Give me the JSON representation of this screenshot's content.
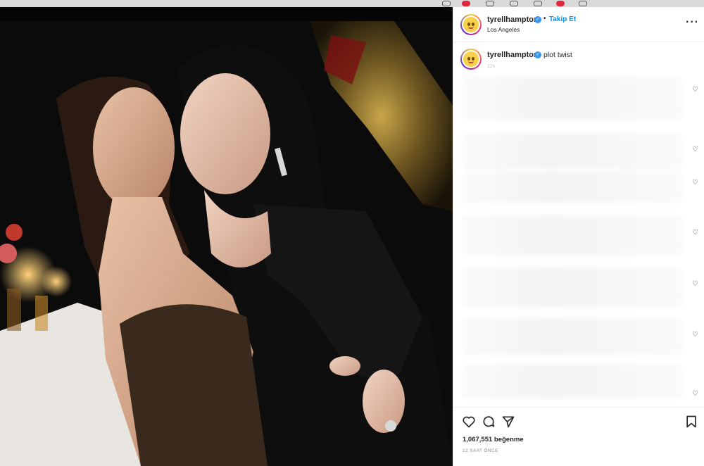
{
  "colors": {
    "accent": "#0095f6",
    "verified": "#3897f0",
    "text": "#262626",
    "muted": "#8e8e8e"
  },
  "post": {
    "username": "tyrellhampton",
    "follow_label": "Takip Et",
    "separator": "•",
    "location": "Los Angeles",
    "more_icon": "more-horizontal-icon"
  },
  "caption": {
    "username": "tyrellhampton",
    "text": "plot twist",
    "time": "12s"
  },
  "comments": {
    "like_icon": "heart-outline-icon"
  },
  "actions": {
    "like_icon": "heart-icon",
    "comment_icon": "comment-icon",
    "share_icon": "share-icon",
    "save_icon": "bookmark-icon",
    "likes_text": "1,067,551 beğenme",
    "post_time": "12 SAAT ÖNCE"
  },
  "topbar": {
    "notification_count": "1"
  }
}
